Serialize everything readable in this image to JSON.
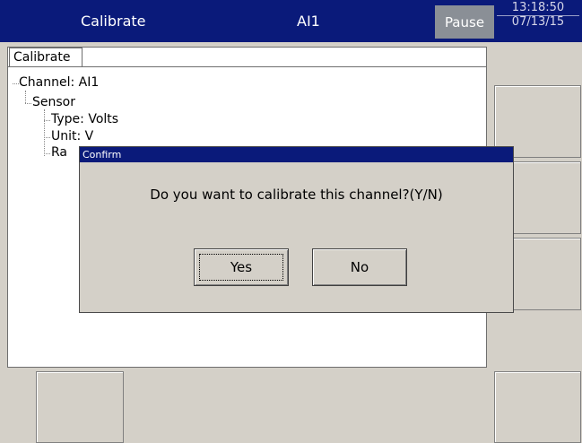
{
  "header": {
    "title": "Calibrate",
    "channel": "AI1",
    "pause_label": "Pause",
    "time": "13:18:50",
    "date": "07/13/15"
  },
  "tab": {
    "label": "Calibrate"
  },
  "tree": {
    "channel": "Channel: AI1",
    "sensor": "Sensor",
    "type": "Type: Volts",
    "unit": "Unit: V",
    "range_partial": "Ra"
  },
  "dialog": {
    "title": "Confirm",
    "message": "Do you want to calibrate this channel?(Y/N)",
    "yes_label": "Yes",
    "no_label": "No"
  },
  "colors": {
    "header_bg": "#0a1a7a",
    "pause_bg": "#8a8f96",
    "window_bg": "#d4d0c8"
  }
}
